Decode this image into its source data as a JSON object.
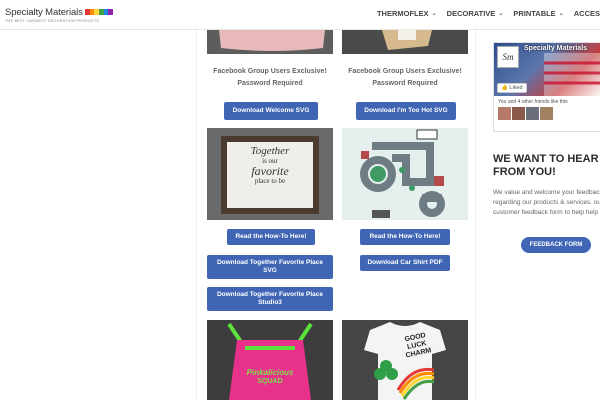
{
  "header": {
    "logo_text": "Specialty Materials",
    "logo_tagline": "THE BEST GARMENT DECORATION PRODUCTS",
    "nav": [
      {
        "label": "THERMOFLEX"
      },
      {
        "label": "DECORATIVE"
      },
      {
        "label": "PRINTABLE"
      },
      {
        "label": "ACCES"
      }
    ]
  },
  "cards": [
    {
      "caption": "Facebook Group Users Exclusive! Password Required",
      "buttons": [
        "Download Welcome SVG"
      ]
    },
    {
      "caption": "Facebook Group Users Exclusive! Password Required",
      "buttons": [
        "Download I'm Too Hot SVG"
      ]
    },
    {
      "image_text": [
        "Together",
        "is our",
        "favorite",
        "place to be"
      ],
      "buttons": [
        "Read the How-To Here!",
        "Download Together Favorite Place SVG",
        "Download Together Favorite Place Studio3"
      ]
    },
    {
      "buttons": [
        "Read the How-To Here!",
        "Download Car Shirt PDF"
      ]
    },
    {
      "image_text": [
        "Pinkalicious",
        "SQUAD"
      ]
    },
    {
      "image_text": [
        "GOOD",
        "LUCK",
        "CHARM"
      ]
    }
  ],
  "sidebar": {
    "fb": {
      "page_name": "Specialty Materials",
      "logo_letters": "Sm",
      "liked_label": "Liked",
      "friends_text": "You and 4 other friends like this"
    },
    "want_heading_line1": "WE WANT TO HEAR",
    "want_heading_line2": "FROM YOU!",
    "want_body": "We value and welcome your feedback regarding our products & services. our customer feedback form to help help you!",
    "feedback_button": "FEEDBACK FORM"
  },
  "colors": {
    "button_blue": "#3f65b4",
    "nav_text": "#444444"
  }
}
